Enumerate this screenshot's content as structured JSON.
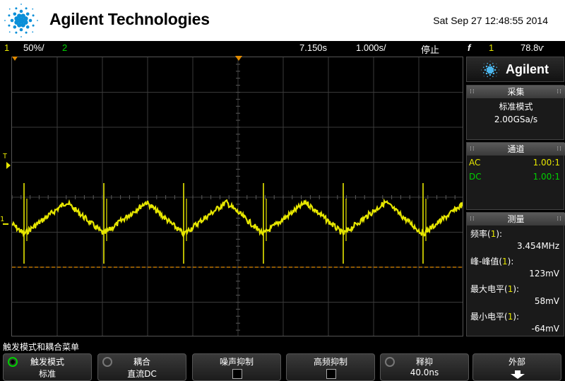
{
  "header": {
    "brand": "Agilent Technologies",
    "datetime": "Sat Sep 27 12:48:55 2014"
  },
  "status_bar": {
    "ch1_num": "1",
    "ch1_scale": "50%/",
    "ch2_num": "2",
    "time_delay": "7.150ѕ",
    "time_scale": "1.000ѕ/",
    "run_state": "停止",
    "trigger_icon": "f",
    "trigger_source": "1",
    "trigger_level": "78.8ѵ"
  },
  "screen": {
    "trigger_marker": "T",
    "channel_marker": "1"
  },
  "panel": {
    "logo": "Agilent",
    "acquire": {
      "title": "采集",
      "mode": "标准模式",
      "rate": "2.00GSa/s"
    },
    "channels": {
      "title": "通道",
      "rows": [
        {
          "coupling": "AC",
          "probe": "1.00:1",
          "color": "#e6e600"
        },
        {
          "coupling": "DC",
          "probe": "1.00:1",
          "color": "#00d000"
        }
      ]
    },
    "measure": {
      "title": "测量",
      "items": [
        {
          "label": "频率",
          "src": "1",
          "value": "3.454MHz"
        },
        {
          "label": "峰-峰值",
          "src": "1",
          "value": "123mV"
        },
        {
          "label": "最大电平",
          "src": "1",
          "value": "58mV"
        },
        {
          "label": "最小电平",
          "src": "1",
          "value": "-64mV"
        }
      ]
    }
  },
  "menu": {
    "title": "触发模式和耦合菜单",
    "softkeys": [
      {
        "title": "触发模式",
        "value": "标准",
        "knob": "active"
      },
      {
        "title": "耦合",
        "value": "直流DC",
        "knob": "inactive"
      },
      {
        "title": "噪声抑制",
        "value": "",
        "control": "checkbox"
      },
      {
        "title": "高频抑制",
        "value": "",
        "control": "checkbox"
      },
      {
        "title": "释抑",
        "value": "40.0ns",
        "knob": "inactive"
      },
      {
        "title": "外部",
        "value": "",
        "control": "arrow-down-icon"
      }
    ]
  },
  "colors": {
    "ch1": "#e6e600",
    "ch2": "#00d000",
    "trigger_level_line": "#e08a00"
  }
}
